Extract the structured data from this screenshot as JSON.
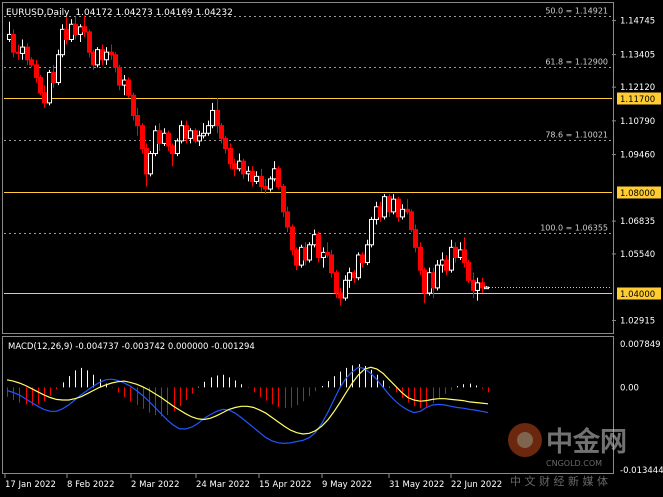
{
  "header": {
    "symbol": "EURUSD,Daily",
    "ohlc": "1.04172 1.04273 1.04169 1.04232"
  },
  "macd_header": "MACD(12,26,9) -0.004737 -0.003742 0.000000 -0.001294",
  "watermark": {
    "brand": "中金网",
    "subtitle": "中 文 财 经 新 媒 体",
    "url": "CNGOLD.COM"
  },
  "colors": {
    "background": "#000000",
    "bull": "#ffffff",
    "bear": "#ff0000",
    "level_line": "#ffcc33",
    "fib_line": "#9a9a9a",
    "macd_line": "#2255ff",
    "signal_line": "#ffff66"
  },
  "chart_data": [
    {
      "type": "candlestick",
      "title": "EURUSD,Daily",
      "x_ticks": [
        "17 Jan 2022",
        "8 Feb 2022",
        "2 Mar 2022",
        "24 Mar 2022",
        "15 Apr 2022",
        "9 May 2022",
        "31 May 2022",
        "22 Jun 2022"
      ],
      "y_ticks": [
        "1.14745",
        "1.13405",
        "1.12120",
        "1.10790",
        "1.09460",
        "1.06835",
        "1.05540",
        "1.02915"
      ],
      "ylim": [
        1.0246,
        1.154
      ],
      "horizontal_levels": [
        {
          "label": "50.0 = 1.14921",
          "value": 1.14921,
          "style": "fib"
        },
        {
          "label": "61.8 = 1.12900",
          "value": 1.129,
          "style": "fib"
        },
        {
          "label": "1.11700",
          "value": 1.117,
          "style": "level"
        },
        {
          "label": "78.6 = 1.10021",
          "value": 1.10021,
          "style": "fib"
        },
        {
          "label": "1.08000",
          "value": 1.08,
          "style": "level"
        },
        {
          "label": "100.0 = 1.06355",
          "value": 1.06355,
          "style": "fib"
        },
        {
          "label": "1.04000",
          "value": 1.04,
          "style": "level"
        }
      ],
      "ohlc": [
        [
          1.14,
          1.147,
          1.139,
          1.142
        ],
        [
          1.142,
          1.144,
          1.133,
          1.135
        ],
        [
          1.135,
          1.138,
          1.132,
          1.1345
        ],
        [
          1.1345,
          1.14,
          1.132,
          1.137
        ],
        [
          1.137,
          1.1385,
          1.13,
          1.132
        ],
        [
          1.132,
          1.133,
          1.129,
          1.13
        ],
        [
          1.13,
          1.132,
          1.123,
          1.125
        ],
        [
          1.125,
          1.126,
          1.118,
          1.119
        ],
        [
          1.119,
          1.122,
          1.113,
          1.115
        ],
        [
          1.115,
          1.128,
          1.114,
          1.127
        ],
        [
          1.127,
          1.13,
          1.121,
          1.123
        ],
        [
          1.123,
          1.136,
          1.122,
          1.134
        ],
        [
          1.134,
          1.146,
          1.133,
          1.144
        ],
        [
          1.144,
          1.149,
          1.138,
          1.14
        ],
        [
          1.14,
          1.148,
          1.139,
          1.146
        ],
        [
          1.146,
          1.149,
          1.14,
          1.142
        ],
        [
          1.142,
          1.146,
          1.139,
          1.145
        ],
        [
          1.145,
          1.1495,
          1.141,
          1.143
        ],
        [
          1.143,
          1.144,
          1.133,
          1.135
        ],
        [
          1.135,
          1.136,
          1.128,
          1.13
        ],
        [
          1.13,
          1.137,
          1.129,
          1.136
        ],
        [
          1.136,
          1.138,
          1.13,
          1.132
        ],
        [
          1.132,
          1.137,
          1.13,
          1.135
        ],
        [
          1.135,
          1.138,
          1.132,
          1.134
        ],
        [
          1.134,
          1.135,
          1.127,
          1.129
        ],
        [
          1.129,
          1.13,
          1.12,
          1.122
        ],
        [
          1.122,
          1.126,
          1.118,
          1.124
        ],
        [
          1.124,
          1.125,
          1.117,
          1.118
        ],
        [
          1.118,
          1.119,
          1.108,
          1.11
        ],
        [
          1.11,
          1.113,
          1.102,
          1.106
        ],
        [
          1.106,
          1.107,
          1.095,
          1.097
        ],
        [
          1.097,
          1.099,
          1.082,
          1.087
        ],
        [
          1.087,
          1.096,
          1.086,
          1.095
        ],
        [
          1.095,
          1.106,
          1.094,
          1.104
        ],
        [
          1.104,
          1.107,
          1.096,
          1.099
        ],
        [
          1.099,
          1.105,
          1.098,
          1.103
        ],
        [
          1.103,
          1.104,
          1.096,
          1.098
        ],
        [
          1.098,
          1.099,
          1.09,
          1.095
        ],
        [
          1.095,
          1.101,
          1.094,
          1.1
        ],
        [
          1.1,
          1.108,
          1.099,
          1.106
        ],
        [
          1.106,
          1.108,
          1.099,
          1.101
        ],
        [
          1.101,
          1.105,
          1.099,
          1.104
        ],
        [
          1.104,
          1.105,
          1.099,
          1.1
        ],
        [
          1.1,
          1.104,
          1.098,
          1.102
        ],
        [
          1.102,
          1.107,
          1.101,
          1.103
        ],
        [
          1.103,
          1.108,
          1.102,
          1.106
        ],
        [
          1.106,
          1.115,
          1.105,
          1.112
        ],
        [
          1.112,
          1.117,
          1.103,
          1.106
        ],
        [
          1.106,
          1.107,
          1.099,
          1.101
        ],
        [
          1.101,
          1.102,
          1.095,
          1.097
        ],
        [
          1.097,
          1.099,
          1.089,
          1.091
        ],
        [
          1.091,
          1.093,
          1.086,
          1.089
        ],
        [
          1.089,
          1.095,
          1.088,
          1.092
        ],
        [
          1.092,
          1.093,
          1.085,
          1.087
        ],
        [
          1.087,
          1.09,
          1.084,
          1.088
        ],
        [
          1.088,
          1.09,
          1.082,
          1.084
        ],
        [
          1.084,
          1.088,
          1.083,
          1.086
        ],
        [
          1.086,
          1.089,
          1.08,
          1.082
        ],
        [
          1.082,
          1.085,
          1.079,
          1.081
        ],
        [
          1.081,
          1.086,
          1.08,
          1.085
        ],
        [
          1.085,
          1.092,
          1.084,
          1.089
        ],
        [
          1.089,
          1.09,
          1.081,
          1.082
        ],
        [
          1.082,
          1.083,
          1.07,
          1.072
        ],
        [
          1.072,
          1.074,
          1.064,
          1.066
        ],
        [
          1.066,
          1.067,
          1.055,
          1.057
        ],
        [
          1.057,
          1.058,
          1.049,
          1.051
        ],
        [
          1.051,
          1.059,
          1.05,
          1.058
        ],
        [
          1.058,
          1.06,
          1.051,
          1.053
        ],
        [
          1.053,
          1.06,
          1.052,
          1.059
        ],
        [
          1.059,
          1.065,
          1.058,
          1.063
        ],
        [
          1.063,
          1.064,
          1.052,
          1.054
        ],
        [
          1.054,
          1.058,
          1.05,
          1.056
        ],
        [
          1.056,
          1.06,
          1.054,
          1.055
        ],
        [
          1.055,
          1.057,
          1.046,
          1.048
        ],
        [
          1.048,
          1.049,
          1.038,
          1.04
        ],
        [
          1.04,
          1.042,
          1.035,
          1.038
        ],
        [
          1.038,
          1.047,
          1.037,
          1.045
        ],
        [
          1.045,
          1.05,
          1.042,
          1.048
        ],
        [
          1.048,
          1.049,
          1.044,
          1.046
        ],
        [
          1.046,
          1.056,
          1.045,
          1.055
        ],
        [
          1.055,
          1.056,
          1.05,
          1.052
        ],
        [
          1.052,
          1.061,
          1.051,
          1.059
        ],
        [
          1.059,
          1.07,
          1.058,
          1.069
        ],
        [
          1.069,
          1.076,
          1.067,
          1.074
        ],
        [
          1.074,
          1.076,
          1.068,
          1.07
        ],
        [
          1.07,
          1.079,
          1.069,
          1.078
        ],
        [
          1.078,
          1.079,
          1.07,
          1.072
        ],
        [
          1.072,
          1.079,
          1.071,
          1.077
        ],
        [
          1.077,
          1.078,
          1.068,
          1.07
        ],
        [
          1.07,
          1.075,
          1.069,
          1.073
        ],
        [
          1.073,
          1.077,
          1.071,
          1.072
        ],
        [
          1.072,
          1.073,
          1.064,
          1.065
        ],
        [
          1.065,
          1.067,
          1.056,
          1.058
        ],
        [
          1.058,
          1.06,
          1.047,
          1.049
        ],
        [
          1.049,
          1.05,
          1.036,
          1.04
        ],
        [
          1.04,
          1.05,
          1.039,
          1.048
        ],
        [
          1.048,
          1.05,
          1.038,
          1.042
        ],
        [
          1.042,
          1.053,
          1.041,
          1.051
        ],
        [
          1.051,
          1.056,
          1.048,
          1.053
        ],
        [
          1.053,
          1.055,
          1.047,
          1.049
        ],
        [
          1.049,
          1.061,
          1.048,
          1.058
        ],
        [
          1.058,
          1.06,
          1.052,
          1.054
        ],
        [
          1.054,
          1.06,
          1.053,
          1.057
        ],
        [
          1.057,
          1.062,
          1.05,
          1.052
        ],
        [
          1.052,
          1.053,
          1.044,
          1.045
        ],
        [
          1.045,
          1.048,
          1.038,
          1.041
        ],
        [
          1.041,
          1.046,
          1.037,
          1.044
        ],
        [
          1.044,
          1.046,
          1.04,
          1.042
        ],
        [
          1.0417,
          1.0427,
          1.0417,
          1.0423
        ]
      ]
    },
    {
      "type": "bar+line",
      "title": "MACD(12,26,9)",
      "y_ticks": [
        "0.007849",
        "0.00",
        "-0.013444"
      ],
      "ylim": [
        -0.013444,
        0.007849
      ],
      "series": [
        {
          "name": "MACD",
          "kind": "histogram",
          "values": [
            -0.0015,
            -0.002,
            -0.0024,
            -0.0027,
            -0.0029,
            -0.0027,
            -0.0022,
            -0.0013,
            -0.0003,
            0.0008,
            0.0018,
            0.0027,
            0.0031,
            0.0027,
            0.002,
            0.0013,
            0.0006,
            -0.0001,
            -0.0008,
            -0.0015,
            -0.0022,
            -0.0028,
            -0.0034,
            -0.004,
            -0.0044,
            -0.0046,
            -0.0044,
            -0.0038,
            -0.003,
            -0.002,
            -0.001,
            0.0001,
            0.0009,
            0.0016,
            0.0019,
            0.002,
            0.0016,
            0.0011,
            0.0005,
            -0.0001,
            -0.0008,
            -0.0015,
            -0.0021,
            -0.0027,
            -0.0031,
            -0.0033,
            -0.0032,
            -0.0028,
            -0.0022,
            -0.0014,
            -0.0006,
            0.0002,
            0.001,
            0.0018,
            0.0025,
            0.0031,
            0.0035,
            0.0037,
            0.0034,
            0.0028,
            0.002,
            0.0011,
            0.0001,
            -0.0008,
            -0.0017,
            -0.0024,
            -0.003,
            -0.0033,
            -0.0031,
            -0.0025,
            -0.0017,
            -0.001,
            -0.0004,
            0.0002,
            0.0005,
            0.0006,
            0.0003,
            -0.0002,
            -0.0008
          ]
        },
        {
          "name": "Signal",
          "kind": "line",
          "values": [
            0.0012,
            0.001,
            0.0007,
            0.0003,
            -0.0002,
            -0.0007,
            -0.0012,
            -0.0016,
            -0.0019,
            -0.002,
            -0.002,
            -0.0018,
            -0.0015,
            -0.001,
            -0.0005,
            0.0,
            0.0004,
            0.0007,
            0.0009,
            0.001,
            0.0008,
            0.0005,
            0.0001,
            -0.0004,
            -0.001,
            -0.0016,
            -0.0023,
            -0.003,
            -0.0036,
            -0.0042,
            -0.0047,
            -0.005,
            -0.0051,
            -0.0049,
            -0.0045,
            -0.004,
            -0.0035,
            -0.0032,
            -0.003,
            -0.003,
            -0.0032,
            -0.0036,
            -0.0041,
            -0.0048,
            -0.0055,
            -0.0062,
            -0.0068,
            -0.0072,
            -0.0074,
            -0.0073,
            -0.0069,
            -0.0062,
            -0.0052,
            -0.0039,
            -0.0024,
            -0.0008,
            0.0007,
            0.002,
            0.0029,
            0.0032,
            0.0029,
            0.0022,
            0.0012,
            0.0002,
            -0.0008,
            -0.0016,
            -0.002,
            -0.0022,
            -0.0021,
            -0.0019,
            -0.0018,
            -0.0018,
            -0.0019,
            -0.002,
            -0.0021,
            -0.0023,
            -0.0024,
            -0.0025,
            -0.0026
          ]
        },
        {
          "name": "Main",
          "kind": "line",
          "values": [
            -0.0005,
            -0.0008,
            -0.0012,
            -0.0018,
            -0.0024,
            -0.003,
            -0.0035,
            -0.0038,
            -0.0038,
            -0.0034,
            -0.0028,
            -0.002,
            -0.0012,
            -0.0005,
            0.0002,
            0.0008,
            0.0012,
            0.0013,
            0.0011,
            0.0007,
            0.0002,
            -0.0005,
            -0.0013,
            -0.0022,
            -0.0032,
            -0.0042,
            -0.0052,
            -0.006,
            -0.0066,
            -0.0066,
            -0.0063,
            -0.0057,
            -0.0049,
            -0.0043,
            -0.0038,
            -0.0035,
            -0.0036,
            -0.0041,
            -0.0048,
            -0.0056,
            -0.0064,
            -0.0072,
            -0.008,
            -0.0085,
            -0.0088,
            -0.0089,
            -0.0088,
            -0.0086,
            -0.0084,
            -0.008,
            -0.0072,
            -0.0058,
            -0.004,
            -0.002,
            0.0,
            0.0015,
            0.0025,
            0.0032,
            0.003,
            0.0022,
            0.0012,
            0.0,
            -0.0012,
            -0.0022,
            -0.003,
            -0.0036,
            -0.004,
            -0.0038,
            -0.0032,
            -0.0028,
            -0.0027,
            -0.0028,
            -0.003,
            -0.0032,
            -0.0033,
            -0.0035,
            -0.0036,
            -0.0038,
            -0.004
          ]
        }
      ]
    }
  ]
}
